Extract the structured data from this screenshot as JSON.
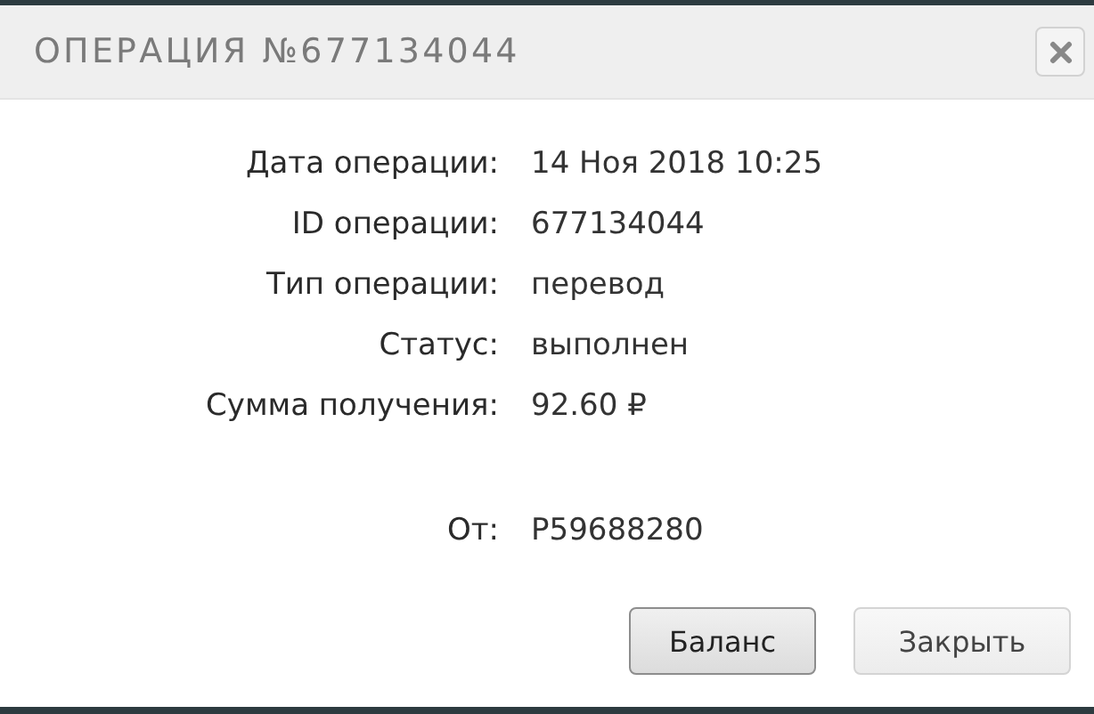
{
  "dialog": {
    "title": "ОПЕРАЦИЯ №677134044"
  },
  "details": [
    {
      "label": "Дата операции:",
      "value": "14 Ноя 2018 10:25"
    },
    {
      "label": "ID операции:",
      "value": "677134044"
    },
    {
      "label": "Тип операции:",
      "value": "перевод"
    },
    {
      "label": "Статус:",
      "value": "выполнен"
    },
    {
      "label": "Сумма получения:",
      "value": "92.60 ₽"
    }
  ],
  "sender": {
    "label": "От:",
    "value": "P59688280"
  },
  "buttons": [
    {
      "label": "Баланс",
      "focused": true
    },
    {
      "label": "Закрыть",
      "focused": false
    }
  ]
}
